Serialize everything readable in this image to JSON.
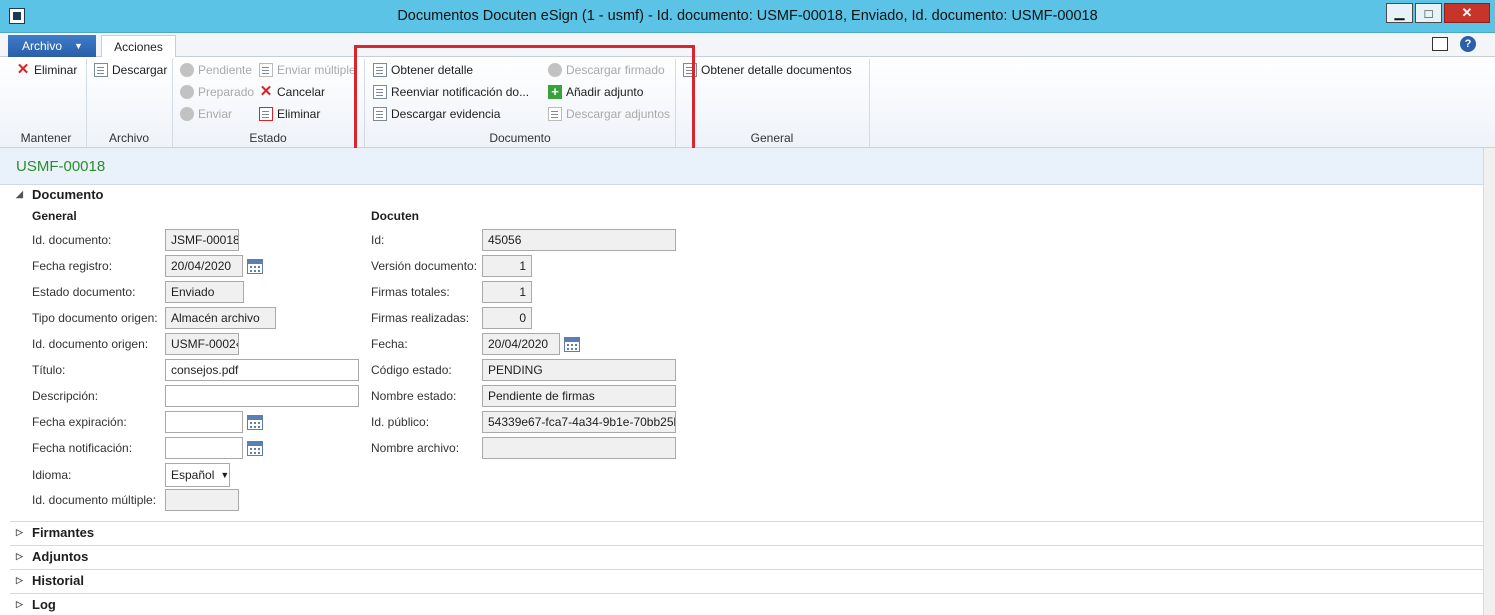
{
  "window": {
    "title": "Documentos Docuten eSign (1 - usmf) - Id. documento: USMF-00018, Enviado, Id. documento: USMF-00018"
  },
  "tabs": {
    "archivo": "Archivo",
    "acciones": "Acciones"
  },
  "ribbon": {
    "mantener": {
      "label": "Mantener",
      "eliminar": "Eliminar"
    },
    "archivo": {
      "label": "Archivo",
      "descargar": "Descargar"
    },
    "estado": {
      "label": "Estado",
      "pendiente": "Pendiente",
      "preparado": "Preparado",
      "enviar": "Enviar",
      "enviar_multiple": "Enviar múltiple",
      "cancelar": "Cancelar",
      "eliminar": "Eliminar"
    },
    "documento": {
      "label": "Documento",
      "obtener_detalle": "Obtener detalle",
      "reenviar": "Reenviar notificación do...",
      "descargar_evidencia": "Descargar evidencia",
      "descargar_firmado": "Descargar firmado",
      "anadir_adjunto": "Añadir adjunto",
      "descargar_adjuntos": "Descargar adjuntos"
    },
    "general": {
      "label": "General",
      "obtener_detalle_documentos": "Obtener detalle documentos"
    }
  },
  "header": {
    "id": "USMF-00018"
  },
  "sections": {
    "documento": "Documento",
    "firmantes": "Firmantes",
    "adjuntos": "Adjuntos",
    "historial": "Historial",
    "log": "Log"
  },
  "general": {
    "title": "General",
    "id_documento": {
      "label": "Id. documento:",
      "value": "JSMF-00018"
    },
    "fecha_registro": {
      "label": "Fecha registro:",
      "value": "20/04/2020"
    },
    "estado_documento": {
      "label": "Estado documento:",
      "value": "Enviado"
    },
    "tipo_documento_origen": {
      "label": "Tipo documento origen:",
      "value": "Almacén archivo"
    },
    "id_documento_origen": {
      "label": "Id. documento origen:",
      "value": "USMF-0002‹"
    },
    "titulo": {
      "label": "Título:",
      "value": "consejos.pdf"
    },
    "descripcion": {
      "label": "Descripción:",
      "value": ""
    },
    "fecha_expiracion": {
      "label": "Fecha expiración:",
      "value": ""
    },
    "fecha_notificacion": {
      "label": "Fecha notificación:",
      "value": ""
    },
    "idioma": {
      "label": "Idioma:",
      "value": "Español"
    },
    "id_documento_multiple": {
      "label": "Id. documento múltiple:",
      "value": ""
    }
  },
  "docuten": {
    "title": "Docuten",
    "id": {
      "label": "Id:",
      "value": "45056"
    },
    "version_documento": {
      "label": "Versión documento:",
      "value": "1"
    },
    "firmas_totales": {
      "label": "Firmas totales:",
      "value": "1"
    },
    "firmas_realizadas": {
      "label": "Firmas realizadas:",
      "value": "0"
    },
    "fecha": {
      "label": "Fecha:",
      "value": "20/04/2020"
    },
    "codigo_estado": {
      "label": "Código estado:",
      "value": "PENDING"
    },
    "nombre_estado": {
      "label": "Nombre estado:",
      "value": "Pendiente de firmas"
    },
    "id_publico": {
      "label": "Id. público:",
      "value": "54339e67-fca7-4a34-9b1e-70bb25b"
    },
    "nombre_archivo": {
      "label": "Nombre archivo:",
      "value": ""
    }
  },
  "colors": {
    "titlebar": "#5ac3e6",
    "archivo_tab": "#2a5ea8",
    "highlight": "#d9262e",
    "header_id": "#2a8c2a"
  }
}
